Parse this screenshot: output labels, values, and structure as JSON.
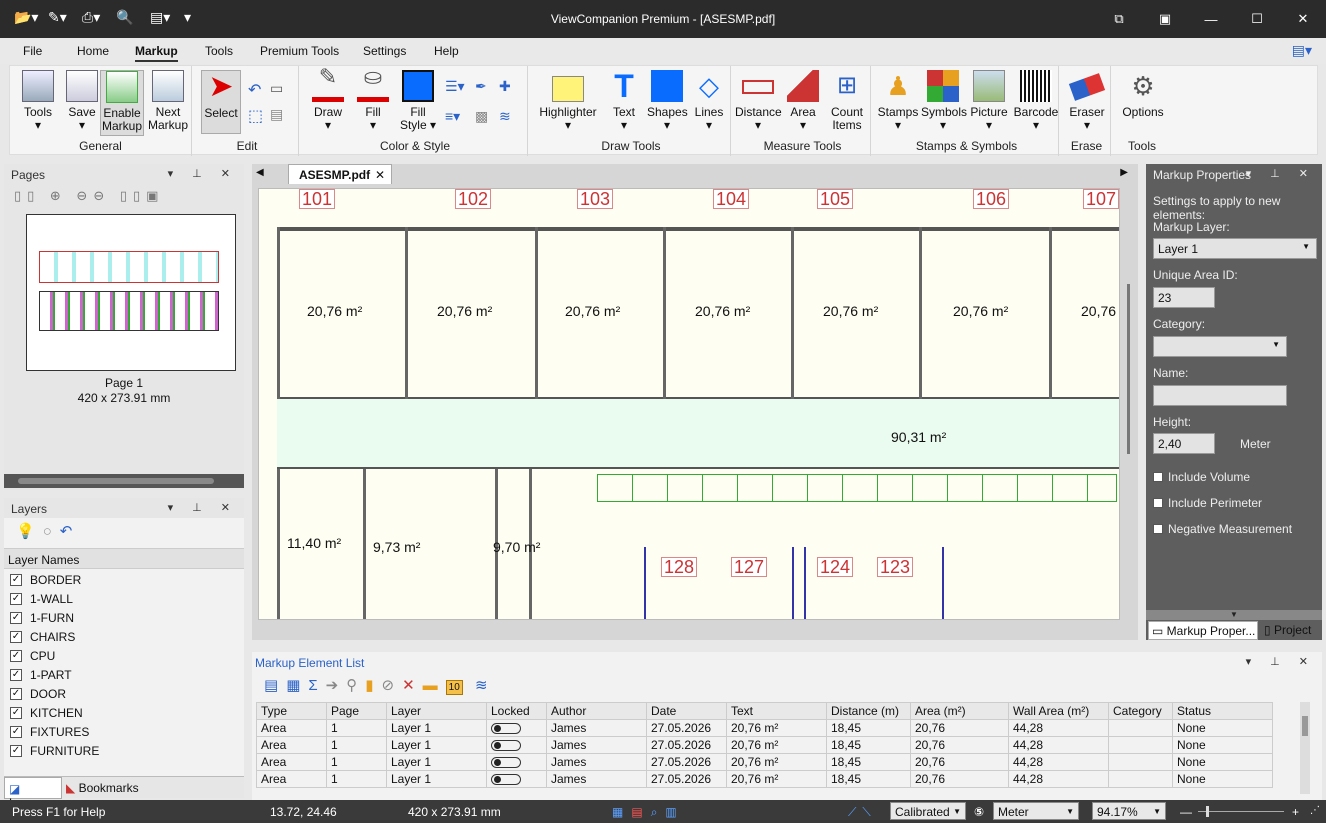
{
  "window": {
    "title": "ViewCompanion Premium - [ASESMP.pdf]"
  },
  "menu": [
    "File",
    "Home",
    "Markup",
    "Tools",
    "Premium Tools",
    "Settings",
    "Help"
  ],
  "ribbon": {
    "general": {
      "label": "General",
      "tools": "Tools",
      "save": "Save",
      "enable1": "Enable",
      "enable2": "Markup",
      "next1": "Next",
      "next2": "Markup"
    },
    "edit": {
      "label": "Edit",
      "select": "Select"
    },
    "color": {
      "label": "Color & Style",
      "draw": "Draw",
      "fill": "Fill",
      "fillstyle1": "Fill",
      "fillstyle2": "Style"
    },
    "drawtools": {
      "label": "Draw Tools",
      "highlighter": "Highlighter",
      "text": "Text",
      "shapes": "Shapes",
      "lines": "Lines"
    },
    "measure": {
      "label": "Measure Tools",
      "distance": "Distance",
      "area": "Area",
      "count1": "Count",
      "count2": "Items"
    },
    "stamps": {
      "label": "Stamps & Symbols",
      "stamps": "Stamps",
      "symbols": "Symbols",
      "picture": "Picture",
      "barcode": "Barcode"
    },
    "erase": {
      "label": "Erase",
      "eraser": "Eraser"
    },
    "tools": {
      "label": "Tools",
      "options": "Options"
    }
  },
  "pages": {
    "title": "Pages",
    "page_label": "Page 1",
    "page_size": "420 x 273.91 mm"
  },
  "layers": {
    "title": "Layers",
    "header": "Layer Names",
    "items": [
      "BORDER",
      "1-WALL",
      "1-FURN",
      "CHAIRS",
      "CPU",
      "1-PART",
      "DOOR",
      "KITCHEN",
      "FIXTURES",
      "FURNITURE"
    ],
    "tab_layers": "Layers",
    "tab_bookmarks": "Bookmarks"
  },
  "doc": {
    "tab": "ASESMP.pdf",
    "rooms": [
      "101",
      "102",
      "103",
      "104",
      "105",
      "106",
      "107",
      "128",
      "127",
      "124",
      "123"
    ],
    "areas": [
      "20,76 m²",
      "20,76 m²",
      "20,76 m²",
      "20,76 m²",
      "20,76 m²",
      "20,76 m²",
      "20,76",
      "90,31 m²",
      "11,40 m²",
      "9,73 m²",
      "9,70 m²"
    ]
  },
  "props": {
    "title": "Markup Properties",
    "intro": "Settings to apply to new elements:",
    "layer_label": "Markup Layer:",
    "layer_value": "Layer 1",
    "uaid_label": "Unique Area ID:",
    "uaid_value": "23",
    "category_label": "Category:",
    "name_label": "Name:",
    "height_label": "Height:",
    "height_value": "2,40",
    "height_unit": "Meter",
    "include_volume": "Include Volume",
    "include_perimeter": "Include Perimeter",
    "negative": "Negative Measurement",
    "tab1": "Markup Proper...",
    "tab2": "Project"
  },
  "mel": {
    "title": "Markup Element List",
    "badge": "10",
    "columns": [
      "Type",
      "Page",
      "Layer",
      "Locked",
      "Author",
      "Date",
      "Text",
      "Distance (m)",
      "Area (m²)",
      "Wall Area (m²)",
      "Category",
      "Status"
    ],
    "rows": [
      [
        "Area",
        "1",
        "Layer 1",
        "",
        "James",
        "27.05.2026",
        "20,76 m²",
        "18,45",
        "20,76",
        "44,28",
        "",
        "None"
      ],
      [
        "Area",
        "1",
        "Layer 1",
        "",
        "James",
        "27.05.2026",
        "20,76 m²",
        "18,45",
        "20,76",
        "44,28",
        "",
        "None"
      ],
      [
        "Area",
        "1",
        "Layer 1",
        "",
        "James",
        "27.05.2026",
        "20,76 m²",
        "18,45",
        "20,76",
        "44,28",
        "",
        "None"
      ],
      [
        "Area",
        "1",
        "Layer 1",
        "",
        "James",
        "27.05.2026",
        "20,76 m²",
        "18,45",
        "20,76",
        "44,28",
        "",
        "None"
      ]
    ]
  },
  "status": {
    "help": "Press F1 for Help",
    "coords": "13.72, 24.46",
    "size": "420 x 273.91 mm",
    "calib": "Calibrated",
    "unit": "Meter",
    "zoom": "94.17%"
  }
}
